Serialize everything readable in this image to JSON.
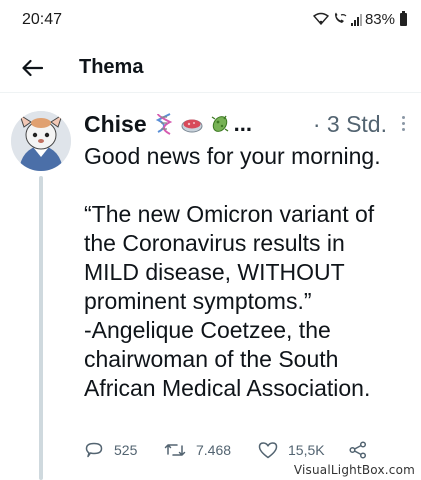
{
  "status_bar": {
    "time": "20:47",
    "battery": "83%"
  },
  "header": {
    "title": "Thema"
  },
  "tweet": {
    "display_name": "Chise",
    "name_emojis": [
      "dna-emoji",
      "petri-dish-emoji",
      "microbe-emoji"
    ],
    "name_truncation": "...",
    "timestamp": "· 3 Std.",
    "lines": [
      "Good news for your morning.",
      "",
      "“The new Omicron variant of",
      "the Coronavirus results in",
      "MILD disease, WITHOUT",
      "prominent symptoms.”",
      "-Angelique Coetzee, the",
      "chairwoman of the South",
      "African Medical Association."
    ],
    "actions": {
      "replies": "525",
      "retweets": "7.468",
      "likes": "15,5K"
    }
  },
  "watermark": "VisualLightBox.com",
  "colors": {
    "text": "#0f1419",
    "secondary": "#536471",
    "thread_line": "#cfd9de"
  }
}
